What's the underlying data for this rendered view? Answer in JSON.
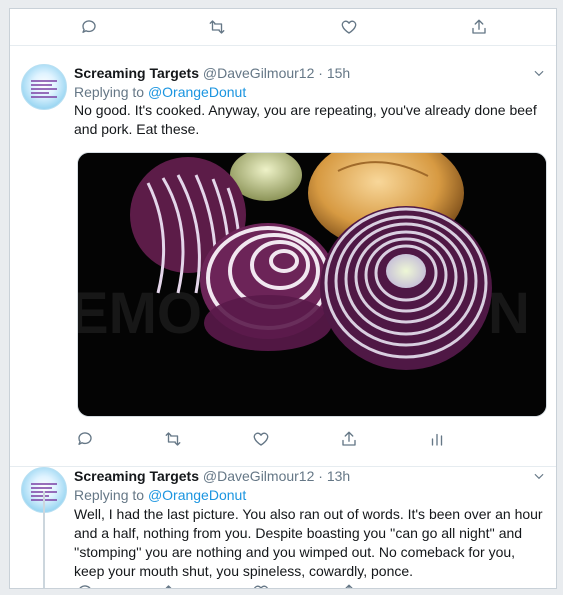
{
  "tweets": [
    {
      "display_name": "Screaming Targets",
      "handle": "@DaveGilmour12",
      "separator": "·",
      "time": "15h",
      "replying_label": "Replying to",
      "replying_to": "@OrangeDonut",
      "text": "No good. It's cooked. Anyway, you are repeating, you've already done beef and pork. Eat these.",
      "media": {
        "watermark": "DEMO",
        "watermark2": "N"
      }
    },
    {
      "display_name": "Screaming Targets",
      "handle": "@DaveGilmour12",
      "separator": "·",
      "time": "13h",
      "replying_label": "Replying to",
      "replying_to": "@OrangeDonut",
      "text": "Well, I had the last picture. You also ran out of words. It's been over an hour and a half, nothing from you. Despite boasting you ''can go all night'' and ''stomping'' you are nothing and you wimped out. No comeback for you, keep your mouth shut, you spineless, cowardly, ponce."
    }
  ],
  "icons": [
    "reply-icon",
    "retweet-icon",
    "like-icon",
    "share-icon",
    "analytics-icon",
    "chevron-down-icon"
  ],
  "colors": {
    "link": "#1b95e0",
    "muted": "#657786",
    "text": "#14171a",
    "onion_red": "#7b2a5e"
  }
}
